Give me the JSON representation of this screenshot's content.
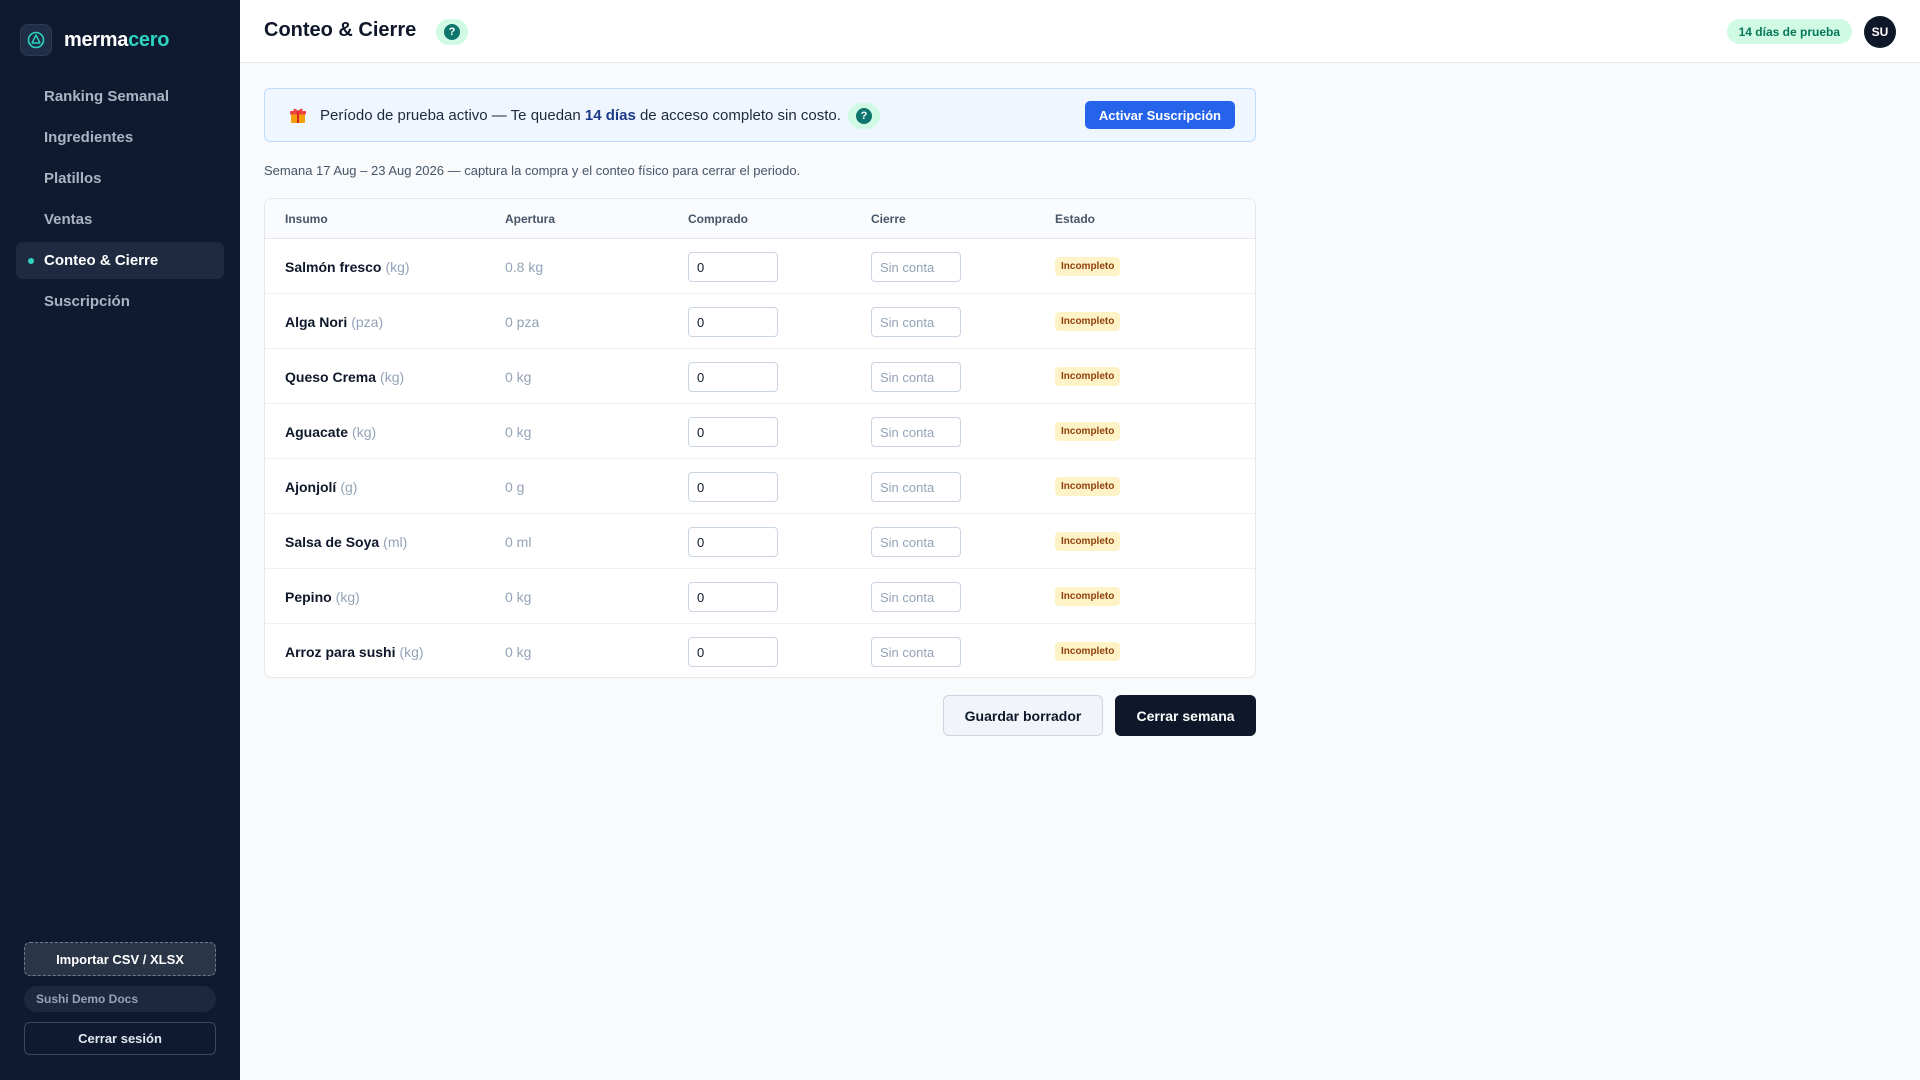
{
  "app": {
    "brand_part1": "merma",
    "brand_part2": "cero",
    "brand_color": "#2dd4bf"
  },
  "sidebar": {
    "items": [
      {
        "label": "Ranking Semanal"
      },
      {
        "label": "Ingredientes"
      },
      {
        "label": "Platillos"
      },
      {
        "label": "Ventas"
      },
      {
        "label": "Conteo & Cierre",
        "active": true
      },
      {
        "label": "Suscripción"
      }
    ],
    "import_label": "Importar CSV / XLSX",
    "workspace_label": "Sushi Demo Docs",
    "logout_label": "Cerrar sesión"
  },
  "header": {
    "title": "Conteo & Cierre",
    "help_glyph": "?",
    "trial_badge": "14 días de prueba",
    "avatar_initials": "SU"
  },
  "banner": {
    "icon": "gift-icon",
    "text_before": "Período de prueba activo — Te quedan ",
    "text_bold": "14 días",
    "text_after": " de acceso completo sin costo.",
    "help_glyph": "?",
    "button_label": "Activar Suscripción",
    "accent_color": "#2563eb"
  },
  "week_note": "Semana 17 Aug – 23 Aug 2026 — captura la compra y el conteo físico para cerrar el periodo.",
  "table": {
    "columns": [
      "Insumo",
      "Apertura",
      "Comprado",
      "Cierre",
      "Estado"
    ],
    "rows": [
      {
        "name": "Salmón fresco",
        "unit": "(kg)",
        "opening": "0.8 kg",
        "purchased": "0",
        "closing_placeholder": "Sin conta",
        "status": "Incompleto"
      },
      {
        "name": "Alga Nori",
        "unit": "(pza)",
        "opening": "0 pza",
        "purchased": "0",
        "closing_placeholder": "Sin conta",
        "status": "Incompleto"
      },
      {
        "name": "Queso Crema",
        "unit": "(kg)",
        "opening": "0 kg",
        "purchased": "0",
        "closing_placeholder": "Sin conta",
        "status": "Incompleto"
      },
      {
        "name": "Aguacate",
        "unit": "(kg)",
        "opening": "0 kg",
        "purchased": "0",
        "closing_placeholder": "Sin conta",
        "status": "Incompleto"
      },
      {
        "name": "Ajonjolí",
        "unit": "(g)",
        "opening": "0 g",
        "purchased": "0",
        "closing_placeholder": "Sin conta",
        "status": "Incompleto"
      },
      {
        "name": "Salsa de Soya",
        "unit": "(ml)",
        "opening": "0 ml",
        "purchased": "0",
        "closing_placeholder": "Sin conta",
        "status": "Incompleto"
      },
      {
        "name": "Pepino",
        "unit": "(kg)",
        "opening": "0 kg",
        "purchased": "0",
        "closing_placeholder": "Sin conta",
        "status": "Incompleto"
      },
      {
        "name": "Arroz para sushi",
        "unit": "(kg)",
        "opening": "0 kg",
        "purchased": "0",
        "closing_placeholder": "Sin conta",
        "status": "Incompleto"
      }
    ],
    "status_color": "#92400e"
  },
  "actions": {
    "save_draft": "Guardar borrador",
    "close_week": "Cerrar semana"
  }
}
